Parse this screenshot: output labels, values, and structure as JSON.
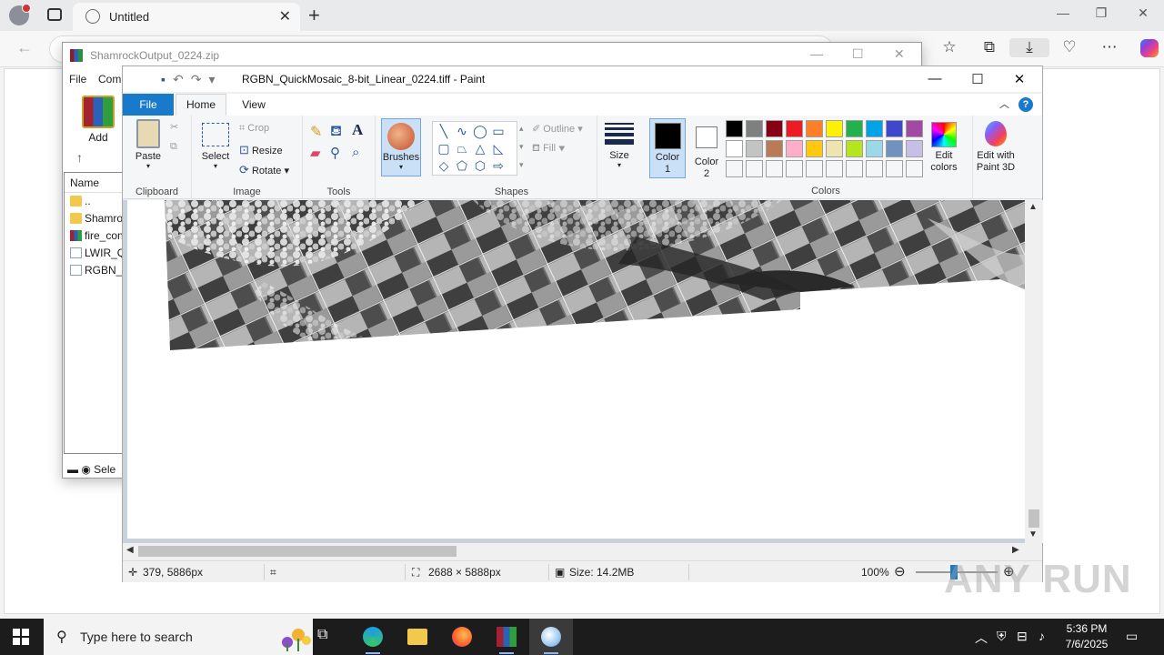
{
  "browser": {
    "tab_title": "Untitled",
    "new_tab": "+",
    "close_tab": "✕"
  },
  "winrar": {
    "title": "ShamrockOutput_0224.zip",
    "menu": [
      "File",
      "Com"
    ],
    "add_label": "Add",
    "list_header": "Name",
    "rows": [
      "..",
      "Shamrock",
      "fire_con",
      "LWIR_Q",
      "RGBN_Q"
    ],
    "status": "Sele"
  },
  "paint": {
    "title": "RGBN_QuickMosaic_8-bit_Linear_0224.tiff - Paint",
    "tabs": {
      "file": "File",
      "home": "Home",
      "view": "View"
    },
    "groups": {
      "clipboard": "Clipboard",
      "image": "Image",
      "tools": "Tools",
      "shapes": "Shapes",
      "colors": "Colors"
    },
    "buttons": {
      "paste": "Paste",
      "select": "Select",
      "crop": "Crop",
      "resize": "Resize",
      "rotate": "Rotate",
      "brushes": "Brushes",
      "outline": "Outline",
      "fill": "Fill",
      "size": "Size",
      "color1": "Color",
      "color1_num": "1",
      "color2": "Color",
      "color2_num": "2",
      "edit_colors_1": "Edit",
      "edit_colors_2": "colors",
      "paint3d_1": "Edit with",
      "paint3d_2": "Paint 3D"
    },
    "palette_row1": [
      "#000000",
      "#7f7f7f",
      "#880015",
      "#ed1c24",
      "#ff7f27",
      "#fff200",
      "#22b14c",
      "#00a2e8",
      "#3f48cc",
      "#a349a4"
    ],
    "palette_row2": [
      "#ffffff",
      "#c3c3c3",
      "#b97a57",
      "#ffaec9",
      "#ffc90e",
      "#efe4b0",
      "#b5e61d",
      "#99d9ea",
      "#7092be",
      "#c8bfe7"
    ],
    "status": {
      "cursor": "379, 5886px",
      "dimensions": "2688 × 5888px",
      "size": "Size: 14.2MB",
      "zoom": "100%"
    }
  },
  "taskbar": {
    "search_placeholder": "Type here to search",
    "time": "5:36 PM",
    "date": "7/6/2025"
  },
  "watermark": "ANY RUN"
}
